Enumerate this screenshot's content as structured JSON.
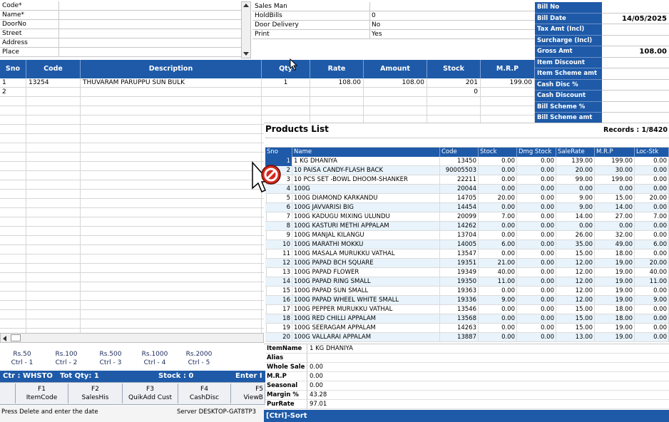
{
  "customer_fields": {
    "labels": [
      "Code*",
      "Name*",
      "DoorNo",
      "Street",
      "Address",
      "Place"
    ]
  },
  "bill_options": {
    "rows": [
      {
        "label": "Sales Man",
        "value": ""
      },
      {
        "label": "HoldBills",
        "value": "0"
      },
      {
        "label": "Door Delivery",
        "value": "No"
      },
      {
        "label": "Print",
        "value": "Yes"
      }
    ]
  },
  "summary": {
    "rows": [
      {
        "label": "Bill No",
        "value": ""
      },
      {
        "label": "Bill Date",
        "value": "14/05/2025"
      },
      {
        "label": "Tax Amt (Incl)",
        "value": ""
      },
      {
        "label": "Surcharge (Incl)",
        "value": ""
      },
      {
        "label": "Gross Amt",
        "value": "108.00"
      },
      {
        "label": "Item Discount",
        "value": ""
      },
      {
        "label": "Item Scheme amt",
        "value": ""
      },
      {
        "label": "Cash Disc %",
        "value": ""
      },
      {
        "label": "Cash Discount",
        "value": ""
      },
      {
        "label": "Bill Scheme %",
        "value": ""
      },
      {
        "label": "Bill Scheme amt",
        "value": ""
      }
    ]
  },
  "bill_grid": {
    "headers": [
      "Sno",
      "Code",
      "Description",
      "Qty",
      "Rate",
      "Amount",
      "Stock",
      "M.R.P"
    ],
    "rows": [
      {
        "sno": "1",
        "code": "13254",
        "desc": "THUVARAM PARUPPU SUN BULK",
        "qty": "1",
        "rate": "108.00",
        "amount": "108.00",
        "stock": "201",
        "mrp": "199.00"
      },
      {
        "sno": "2",
        "code": "",
        "desc": "",
        "qty": "",
        "rate": "",
        "amount": "",
        "stock": "0",
        "mrp": ""
      }
    ]
  },
  "products": {
    "title": "Products List",
    "records": "Records : 1/8420",
    "headers": [
      "Sno",
      "Name",
      "Code",
      "Stock",
      "Dmg Stock",
      "SaleRate",
      "M.R.P",
      "Loc-Stk"
    ],
    "rows": [
      [
        "1",
        "1 KG DHANIYA",
        "13450",
        "0.00",
        "0.00",
        "139.00",
        "199.00",
        "0.00"
      ],
      [
        "2",
        "10 PAISA CANDY-FLASH BACK",
        "90005503",
        "0.00",
        "0.00",
        "20.00",
        "30.00",
        "0.00"
      ],
      [
        "3",
        "10 PCS SET -BOWL DHOOM-SHANKER",
        "22211",
        "0.00",
        "0.00",
        "99.00",
        "199.00",
        "0.00"
      ],
      [
        "4",
        "100G",
        "20044",
        "0.00",
        "0.00",
        "0.00",
        "0.00",
        "0.00"
      ],
      [
        "5",
        "100G DIAMOND KARKANDU",
        "14705",
        "20.00",
        "0.00",
        "9.00",
        "15.00",
        "20.00"
      ],
      [
        "6",
        "100G JAVVARISI BIG",
        "14454",
        "0.00",
        "0.00",
        "9.00",
        "14.00",
        "0.00"
      ],
      [
        "7",
        "100G KADUGU MIXING ULUNDU",
        "20099",
        "7.00",
        "0.00",
        "14.00",
        "27.00",
        "7.00"
      ],
      [
        "8",
        "100G KASTURI METHI APPALAM",
        "14262",
        "0.00",
        "0.00",
        "0.00",
        "0.00",
        "0.00"
      ],
      [
        "9",
        "100G MANJAL KILANGU",
        "13704",
        "0.00",
        "0.00",
        "26.00",
        "32.00",
        "0.00"
      ],
      [
        "10",
        "100G MARATHI MOKKU",
        "14005",
        "6.00",
        "0.00",
        "35.00",
        "49.00",
        "6.00"
      ],
      [
        "11",
        "100G MASALA MURUKKU VATHAL",
        "13547",
        "0.00",
        "0.00",
        "15.00",
        "18.00",
        "0.00"
      ],
      [
        "12",
        "100G PAPAD BCH SQUARE",
        "19351",
        "21.00",
        "0.00",
        "12.00",
        "19.00",
        "20.00"
      ],
      [
        "13",
        "100G PAPAD FLOWER",
        "19349",
        "40.00",
        "0.00",
        "12.00",
        "19.00",
        "40.00"
      ],
      [
        "14",
        "100G PAPAD RING SMALL",
        "19350",
        "11.00",
        "0.00",
        "12.00",
        "19.00",
        "11.00"
      ],
      [
        "15",
        "100G PAPAD SUN SMALL",
        "19363",
        "0.00",
        "0.00",
        "12.00",
        "19.00",
        "0.00"
      ],
      [
        "16",
        "100G PAPAD WHEEL WHITE SMALL",
        "19336",
        "9.00",
        "0.00",
        "12.00",
        "19.00",
        "9.00"
      ],
      [
        "17",
        "100G PEPPER MURUKKU VATHAL",
        "13546",
        "0.00",
        "0.00",
        "15.00",
        "18.00",
        "0.00"
      ],
      [
        "18",
        "100G RED CHILLI APPALAM",
        "13568",
        "0.00",
        "0.00",
        "15.00",
        "18.00",
        "0.00"
      ],
      [
        "19",
        "100G SEERAGAM APPALAM",
        "14263",
        "0.00",
        "0.00",
        "15.00",
        "19.00",
        "0.00"
      ],
      [
        "20",
        "100G VALLARAI APPALAM",
        "13887",
        "0.00",
        "0.00",
        "13.00",
        "19.00",
        "0.00"
      ]
    ]
  },
  "item_details": {
    "rows": [
      {
        "label": "ItemName",
        "value": "1 KG DHANIYA"
      },
      {
        "label": "Alias",
        "value": ""
      },
      {
        "label": "Whole Sale",
        "value": "0.00"
      },
      {
        "label": "M.R.P",
        "value": "0.00"
      },
      {
        "label": "Seasonal",
        "value": "0.00"
      },
      {
        "label": "Margin %",
        "value": "43.28"
      },
      {
        "label": "PurRate",
        "value": "97.01"
      }
    ]
  },
  "denominations": [
    {
      "amt": "Rs.50",
      "key": "Ctrl - 1"
    },
    {
      "amt": "Rs.100",
      "key": "Ctrl - 2"
    },
    {
      "amt": "Rs.500",
      "key": "Ctrl - 3"
    },
    {
      "amt": "Rs.1000",
      "key": "Ctrl - 4"
    },
    {
      "amt": "Rs.2000",
      "key": "Ctrl - 5"
    }
  ],
  "status_bar": {
    "ctr": "Ctr : WHSTO",
    "tot_qty": "Tot Qty: 1",
    "stock": "Stock : 0",
    "enter": "Enter I"
  },
  "fkeys": [
    {
      "key": "F1",
      "label": "ItemCode"
    },
    {
      "key": "F2",
      "label": "SalesHis"
    },
    {
      "key": "F3",
      "label": "QuikAdd Cust"
    },
    {
      "key": "F4",
      "label": "CashDisc"
    },
    {
      "key": "F5",
      "label": "ViewB"
    }
  ],
  "footer": {
    "hint": "Press Delete and enter the date",
    "server": "Server  DESKTOP-GAT8TP3",
    "sort": "[Ctrl]-Sort"
  },
  "colors": {
    "header_blue": "#1e5aa8",
    "selected_row": "#1e5aa8",
    "alt_row": "#e8f3fb"
  },
  "icons": {
    "cursor": "arrow-cursor",
    "no_entry": "no-entry-icon",
    "dropdown": "triangle-down-icon"
  }
}
